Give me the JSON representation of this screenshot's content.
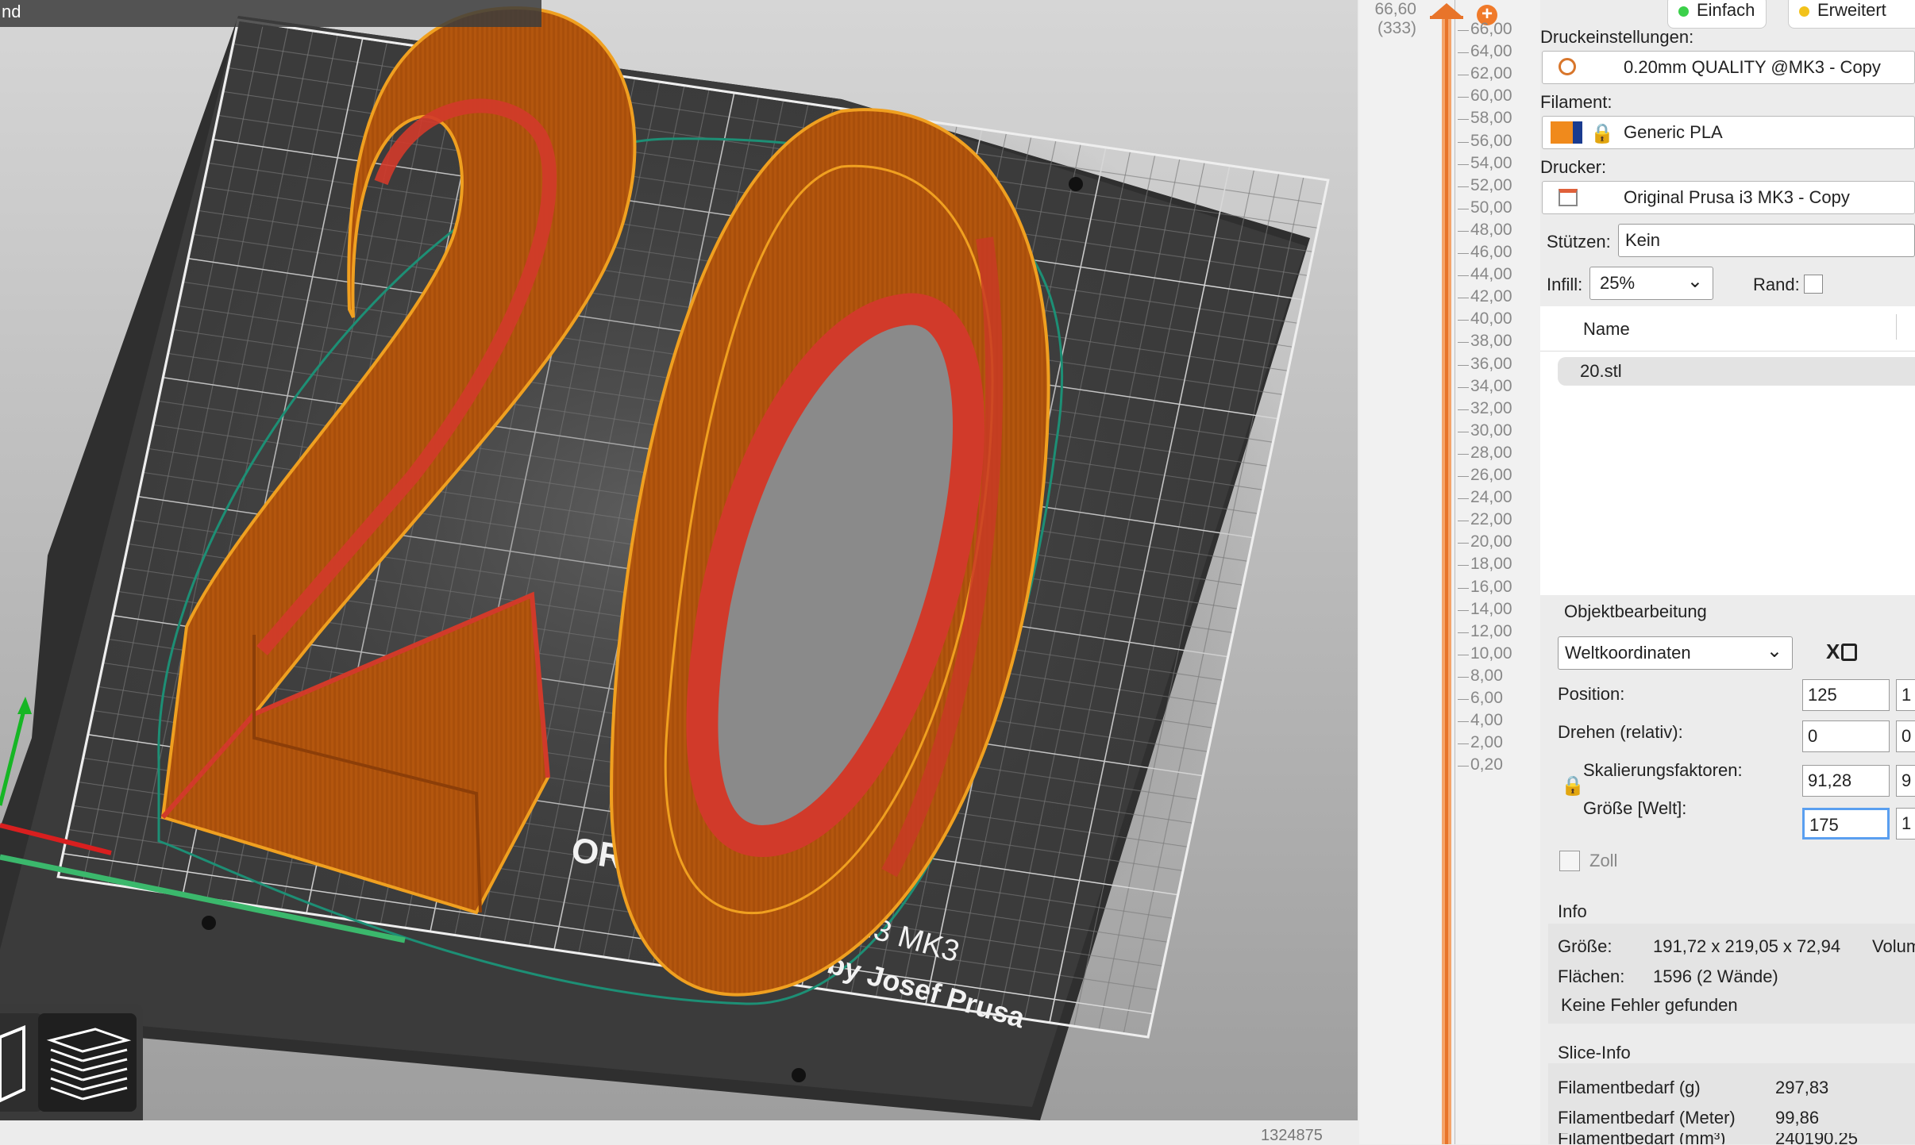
{
  "viewport": {
    "tab_fragment": "nd",
    "model_text": "20",
    "bed_labels": {
      "brand_fragment": "OR",
      "model": "i3  MK3",
      "author": "by Josef Prusa"
    },
    "toolbar": {
      "btn_3d_icon": "cube-view-icon",
      "btn_preview_icon": "layers-view-icon"
    }
  },
  "status": {
    "count": "1324875"
  },
  "layer_slider": {
    "top_value": "66,60",
    "top_layer": "(333)",
    "ticks": [
      "66,00",
      "64,00",
      "62,00",
      "60,00",
      "58,00",
      "56,00",
      "54,00",
      "52,00",
      "50,00",
      "48,00",
      "46,00",
      "44,00",
      "42,00",
      "40,00",
      "38,00",
      "36,00",
      "34,00",
      "32,00",
      "30,00",
      "28,00",
      "26,00",
      "24,00",
      "22,00",
      "20,00",
      "18,00",
      "16,00",
      "14,00",
      "12,00",
      "10,00",
      "8,00",
      "6,00",
      "4,00",
      "2,00",
      "0,20"
    ],
    "add_icon": "+"
  },
  "sidebar": {
    "modes": {
      "simple": "Einfach",
      "advanced": "Erweitert"
    },
    "print_settings": {
      "label": "Druckeinstellungen:",
      "value": "0.20mm QUALITY @MK3 - Copy"
    },
    "filament": {
      "label": "Filament:",
      "value": "Generic PLA"
    },
    "printer": {
      "label": "Drucker:",
      "value": "Original Prusa i3 MK3 - Copy"
    },
    "supports": {
      "label": "Stützen:",
      "value": "Kein"
    },
    "infill": {
      "label": "Infill:",
      "value": "25%"
    },
    "brim": {
      "label": "Rand:"
    },
    "object_list": {
      "header": "Name",
      "items": [
        "20.stl"
      ]
    },
    "manipulation": {
      "title": "Objektbearbeitung",
      "coordinates": "Weltkoordinaten",
      "axis_x": "X",
      "position": {
        "label": "Position:",
        "value": "125"
      },
      "rotation": {
        "label": "Drehen (relativ):",
        "value": "0"
      },
      "scale": {
        "label": "Skalierungsfaktoren:",
        "value": "91,28"
      },
      "size": {
        "label": "Größe [Welt]:",
        "value": "175"
      },
      "inches": "Zoll",
      "clipped": {
        "position_y": "1",
        "rotation_y": "0",
        "scale_y": "9",
        "size_y": "1"
      }
    },
    "info": {
      "title": "Info",
      "size_label": "Größe:",
      "size_value": "191,72 x 219,05 x 72,94",
      "volume_label": "Volum",
      "facets_label": "Flächen:",
      "facets_value": "1596 (2 Wände)",
      "errors": "Keine Fehler gefunden"
    },
    "slice_info": {
      "title": "Slice-Info",
      "grams_label": "Filamentbedarf (g)",
      "grams_value": "297,83",
      "meters_label": "Filamentbedarf (Meter)",
      "meters_value": "99,86",
      "mm3_label": "Filamentbedarf (mm³)",
      "mm3_value": "240190,25"
    }
  },
  "colors": {
    "accent": "#e8742a",
    "filament": "#f08a1c",
    "print_body": "#b8580f",
    "print_inner": "#d13a2a",
    "bed": "#3b3b3b"
  }
}
